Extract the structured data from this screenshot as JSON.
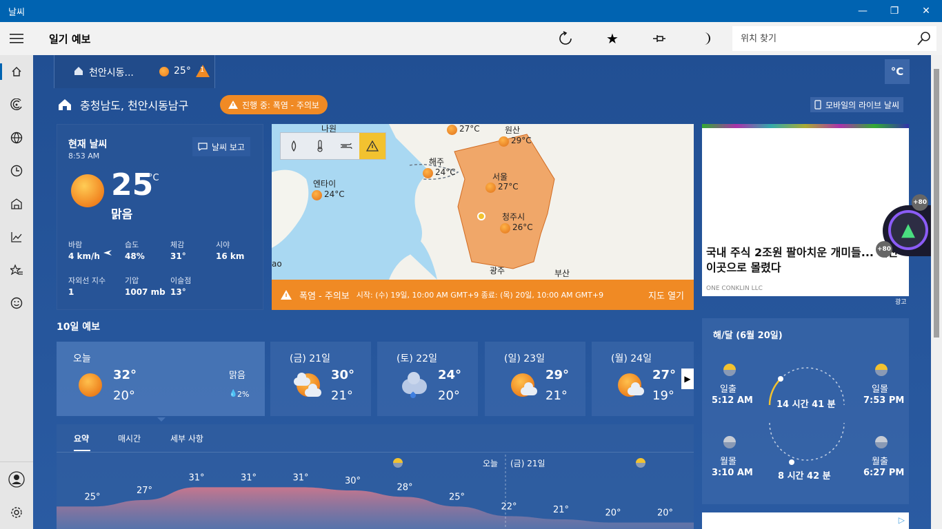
{
  "window": {
    "title": "날씨",
    "minimize": "—",
    "maximize": "❐",
    "close": "✕"
  },
  "header": {
    "page_title": "일기 예보",
    "search_placeholder": "위치 찾기"
  },
  "location_tab": {
    "name": "천안시동...",
    "temp": "25°",
    "alert_count": "1"
  },
  "unit": "°C",
  "location": {
    "title": "충청남도, 천안시동남구",
    "alert": "진행 중: 폭염 - 주의보",
    "mobile": "모바일의 라이브 날씨"
  },
  "current": {
    "heading": "현재 날씨",
    "time": "8:53 AM",
    "report_label": "날씨 보고",
    "temp": "25",
    "unit": "°C",
    "condition": "맑음",
    "metrics": [
      {
        "label": "바람",
        "value": "4 km/h"
      },
      {
        "label": "습도",
        "value": "48%"
      },
      {
        "label": "체감",
        "value": "31°"
      },
      {
        "label": "시야",
        "value": "16 km"
      },
      {
        "label": "자외선 지수",
        "value": "1"
      },
      {
        "label": "기압",
        "value": "1007 mb"
      },
      {
        "label": "이슬점",
        "value": "13°"
      }
    ]
  },
  "map": {
    "cities": [
      {
        "name": "나원",
        "temp": "27°C"
      },
      {
        "name": "원산",
        "temp": "29°C"
      },
      {
        "name": "해주",
        "temp": "24°C"
      },
      {
        "name": "엔타이",
        "temp": "24°C"
      },
      {
        "name": "서울",
        "temp": "27°C"
      },
      {
        "name": "청주시",
        "temp": "26°C"
      },
      {
        "name": "광주",
        "temp": ""
      },
      {
        "name": "부산",
        "temp": ""
      },
      {
        "name": "ao",
        "temp": ""
      }
    ],
    "banner_title": "폭염 - 주의보",
    "banner_detail": "시작: (수) 19일, 10:00 AM GMT+9 종료: (목) 20일, 10:00 AM GMT+9",
    "open_map": "지도 열기"
  },
  "ad": {
    "headline": "국내 주식 2조원 팔아치운 개미들... 대신 이곳으로 몰렸다",
    "sponsor": "ONE CONKLIN LLC",
    "label": "광고",
    "badge": "+80"
  },
  "forecast": {
    "title": "10일 예보",
    "days": [
      {
        "label": "오늘",
        "hi": "32°",
        "lo": "20°",
        "cond": "맑음",
        "precip": "2%"
      },
      {
        "label": "(금) 21일",
        "hi": "30°",
        "lo": "21°"
      },
      {
        "label": "(토) 22일",
        "hi": "24°",
        "lo": "20°"
      },
      {
        "label": "(일) 23일",
        "hi": "29°",
        "lo": "21°"
      },
      {
        "label": "(월) 24일",
        "hi": "27°",
        "lo": "19°"
      }
    ]
  },
  "summary": {
    "tabs": [
      "요약",
      "매시간",
      "세부 사항"
    ],
    "today_label": "오늘",
    "next_label": "(금) 21일"
  },
  "chart_data": {
    "type": "area",
    "series": [
      {
        "values": [
          25,
          27,
          31,
          31,
          31,
          30,
          28,
          25,
          22,
          21,
          20,
          20
        ]
      }
    ],
    "labels": [
      "25°",
      "27°",
      "31°",
      "31°",
      "31°",
      "30°",
      "28°",
      "25°",
      "22°",
      "21°",
      "20°",
      "20°"
    ]
  },
  "sunmoon": {
    "title": "해/달 (6월 20일)",
    "sunrise_label": "일출",
    "sunrise": "5:12 AM",
    "sunset_label": "일몰",
    "sunset": "7:53 PM",
    "sun_duration": "14 시간 41 분",
    "moonset_label": "월몰",
    "moonset": "3:10 AM",
    "moonrise_label": "월출",
    "moonrise": "6:27 PM",
    "moon_duration": "8 시간 42 분"
  },
  "colors": {
    "accent": "#0063b1",
    "alert": "#f08a24",
    "background": "#1f4f93"
  }
}
